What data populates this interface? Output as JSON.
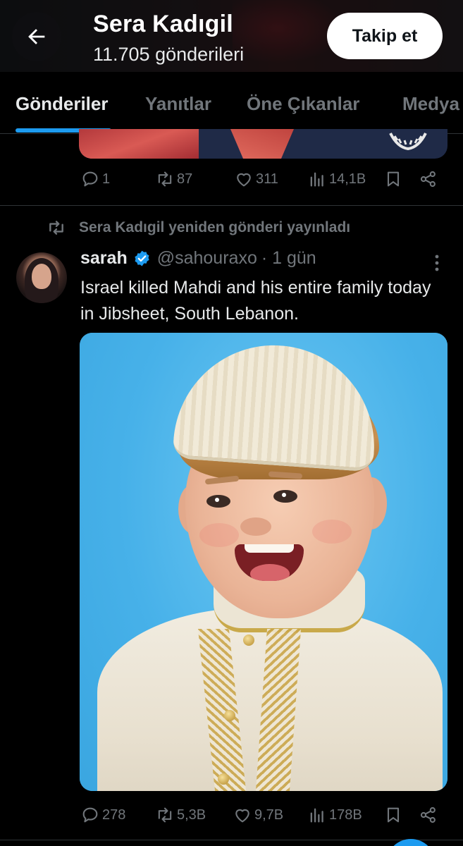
{
  "header": {
    "name": "Sera Kadıgil",
    "post_count": "11.705 gönderileri",
    "follow_label": "Takip et"
  },
  "tabs": [
    {
      "label": "Gönderiler",
      "active": true
    },
    {
      "label": "Yanıtlar",
      "active": false
    },
    {
      "label": "Öne Çıkanlar",
      "active": false
    },
    {
      "label": "Medya",
      "active": false
    }
  ],
  "prev_tweet": {
    "actions": {
      "replies": "1",
      "reposts": "87",
      "likes": "311",
      "views": "14,1B"
    }
  },
  "retweet": {
    "reposted_by": "Sera Kadıgil yeniden gönderi yayınladı",
    "author_name": "sarah",
    "handle": "@sahouraxo",
    "time": "· 1 gün",
    "text": "Israel killed Mahdi and his entire family today in Jibsheet, South Lebanon.",
    "actions": {
      "replies": "278",
      "reposts": "5,3B",
      "likes": "9,7B",
      "views": "178B"
    }
  },
  "colors": {
    "accent": "#1d9bf0",
    "muted": "#71767b",
    "text": "#e7e9ea",
    "background": "#000000"
  }
}
